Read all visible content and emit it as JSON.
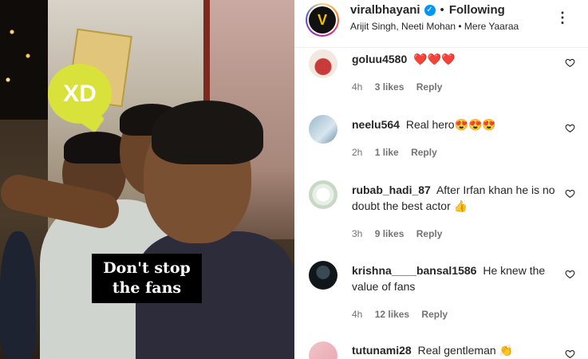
{
  "media": {
    "sticker_text": "XD",
    "caption_line1": "Don't stop",
    "caption_line2": "the fans"
  },
  "post": {
    "username": "viralbhayani",
    "separator": "•",
    "follow_status": "Following",
    "audio": "Arijit Singh, Neeti Mohan • Mere Yaaraa",
    "more_icon": "more-options-icon",
    "verified_color": "#0095f6"
  },
  "comments": [
    {
      "user": "goluu4580",
      "text": "❤️❤️❤️",
      "age": "4h",
      "likes": "3 likes",
      "reply": "Reply"
    },
    {
      "user": "neelu564",
      "text": "Real hero😍😍😍",
      "age": "2h",
      "likes": "1 like",
      "reply": "Reply"
    },
    {
      "user": "rubab_hadi_87",
      "text": "After Irfan khan he is no doubt the best actor 👍",
      "age": "3h",
      "likes": "9 likes",
      "reply": "Reply"
    },
    {
      "user": "krishna____bansal1586",
      "text": "He knew the value of fans",
      "age": "4h",
      "likes": "12 likes",
      "reply": "Reply"
    },
    {
      "user": "tutunami28",
      "text": "Real gentleman 👏",
      "age": "",
      "likes": "",
      "reply": ""
    }
  ]
}
